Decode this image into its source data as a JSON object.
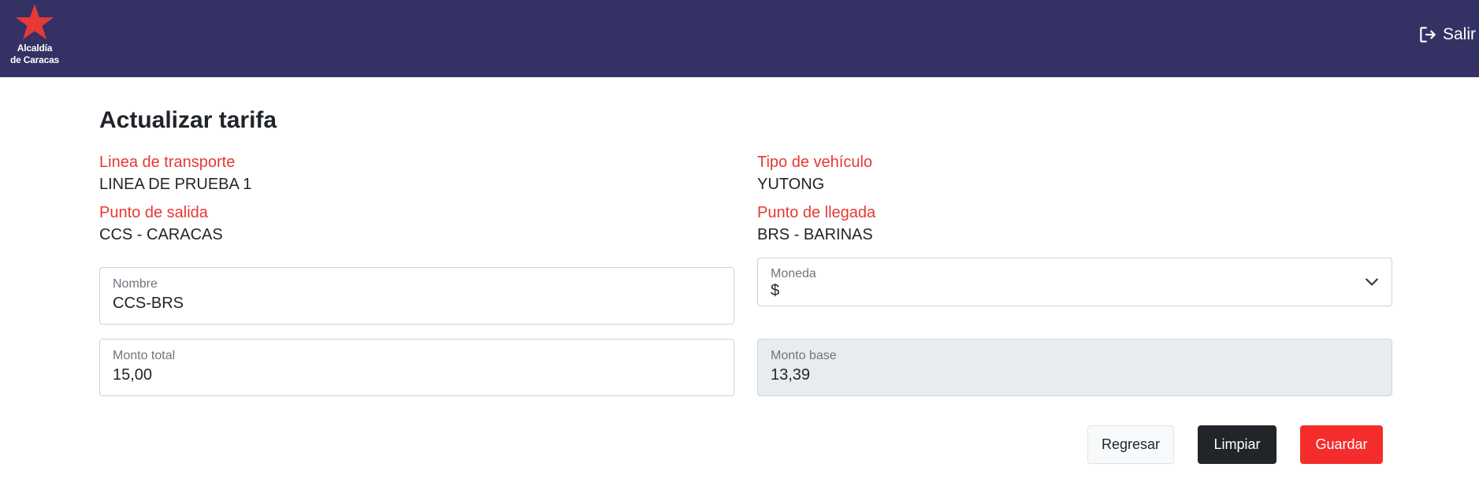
{
  "header": {
    "logo_text_line1": "Alcaldía",
    "logo_text_line2": "de Caracas",
    "logout_label": "Salir",
    "bg_color": "#343264",
    "brand_color": "#e53935"
  },
  "page": {
    "title": "Actualizar tarifa"
  },
  "info": {
    "linea_label": "Linea de transporte",
    "linea_value": "LINEA DE PRUEBA 1",
    "tipo_label": "Tipo de vehículo",
    "tipo_value": "YUTONG",
    "salida_label": "Punto de salida",
    "salida_value": "CCS - CARACAS",
    "llegada_label": "Punto de llegada",
    "llegada_value": "BRS - BARINAS"
  },
  "form": {
    "nombre_label": "Nombre",
    "nombre_value": "CCS-BRS",
    "moneda_label": "Moneda",
    "moneda_value": "$",
    "monto_total_label": "Monto total",
    "monto_total_value": "15,00",
    "monto_base_label": "Monto base",
    "monto_base_value": "13,39"
  },
  "actions": {
    "back_label": "Regresar",
    "clear_label": "Limpiar",
    "save_label": "Guardar"
  }
}
